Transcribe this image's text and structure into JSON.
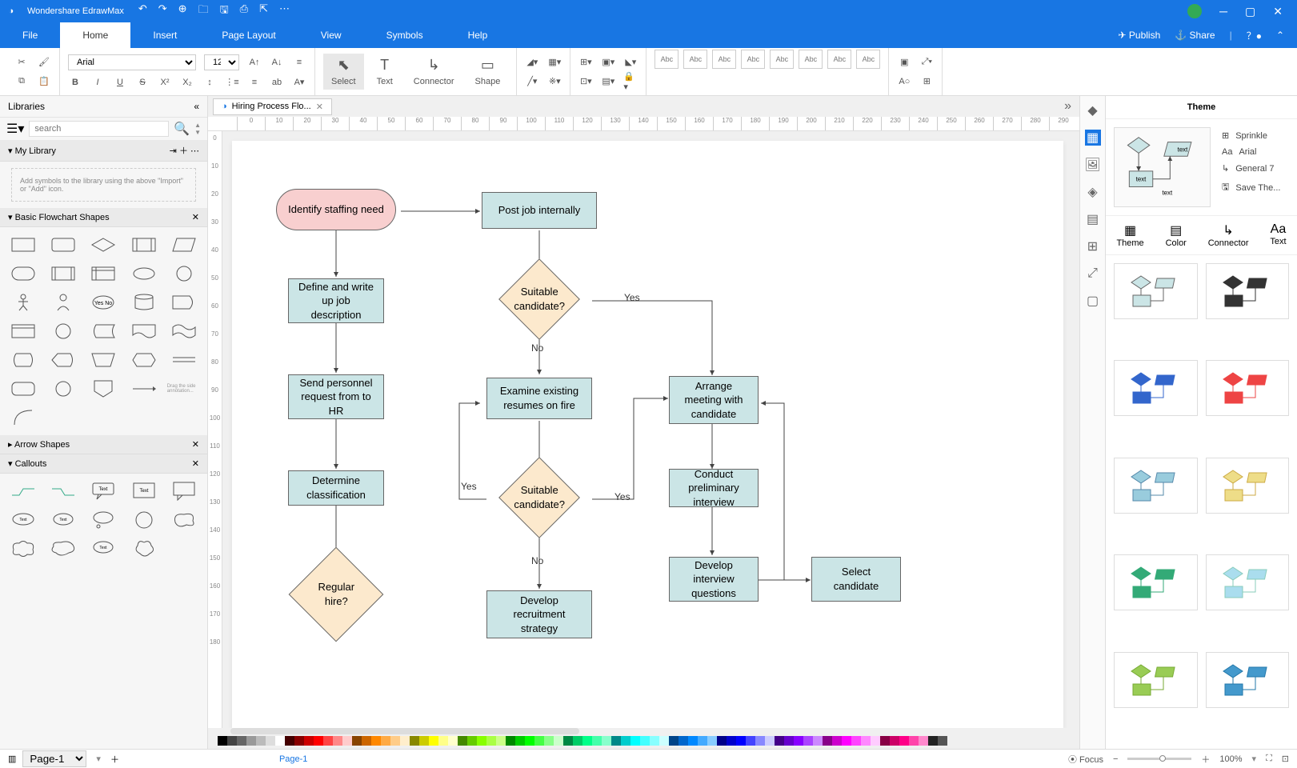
{
  "app_title": "Wondershare EdrawMax",
  "menus": [
    "File",
    "Home",
    "Insert",
    "Page Layout",
    "View",
    "Symbols",
    "Help"
  ],
  "active_menu": "Home",
  "menubar_right": {
    "publish": "Publish",
    "share": "Share"
  },
  "toolbar": {
    "font": "Arial",
    "size": "12",
    "tools": {
      "select": "Select",
      "text": "Text",
      "connector": "Connector",
      "shape": "Shape"
    },
    "style_abc": "Abc"
  },
  "libraries": {
    "title": "Libraries",
    "search_placeholder": "search",
    "my_library": "My Library",
    "add_hint": "Add symbols to the library using the above \"Import\" or \"Add\" icon.",
    "basic": "Basic Flowchart Shapes",
    "arrow": "Arrow Shapes",
    "callouts": "Callouts",
    "yesno": "Yes No"
  },
  "file_tab": "Hiring Process Flo...",
  "flow": {
    "identify": "Identify staffing need",
    "define": "Define and write up job description",
    "send": "Send personnel request from to HR",
    "determine": "Determine classification",
    "regular": "Regular hire?",
    "post": "Post job internally",
    "suitable": "Suitable candidate?",
    "examine": "Examine existing resumes on fire",
    "suitable2": "Suitable candidate?",
    "develop_rec": "Develop recruitment strategy",
    "arrange": "Arrange meeting with candidate",
    "conduct": "Conduct preliminary interview",
    "develop_q": "Develop interview questions",
    "select": "Select candidate",
    "yes": "Yes",
    "no": "No"
  },
  "theme": {
    "title": "Theme",
    "sprinkle": "Sprinkle",
    "font": "Arial",
    "connector": "General 7",
    "save": "Save The...",
    "tabs": [
      "Theme",
      "Color",
      "Connector",
      "Text"
    ],
    "text": "text"
  },
  "statusbar": {
    "page_dropdown": "Page-1",
    "page": "Page-1",
    "focus": "Focus",
    "zoom": "100%"
  },
  "ruler_h": [
    "0",
    "10",
    "20",
    "30",
    "40",
    "50",
    "60",
    "70",
    "80",
    "90",
    "100",
    "110",
    "120",
    "130",
    "140",
    "150",
    "160",
    "170",
    "180",
    "190",
    "200",
    "210",
    "220",
    "230",
    "240",
    "250",
    "260",
    "270",
    "280",
    "290"
  ],
  "ruler_v": [
    "0",
    "10",
    "20",
    "30",
    "40",
    "50",
    "60",
    "70",
    "80",
    "90",
    "100",
    "110",
    "120",
    "130",
    "140",
    "150",
    "160",
    "170",
    "180"
  ]
}
